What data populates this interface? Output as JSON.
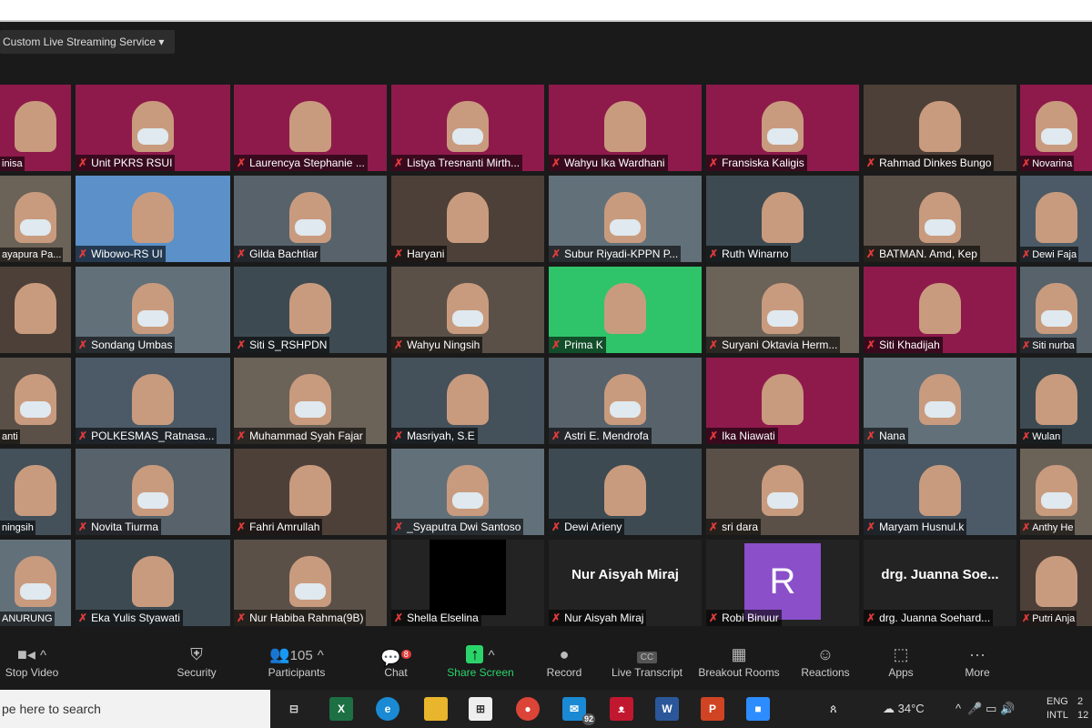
{
  "meeting": {
    "stream_label": "Custom Live Streaming Service",
    "active_speaker": "Unit PKRS RSUI"
  },
  "grid": [
    [
      "inisa",
      "Unit PKRS RSUI",
      "Laurencya Stephanie ...",
      "Listya Tresnanti Mirth...",
      "Wahyu Ika Wardhani",
      "Fransiska Kaligis",
      "Rahmad Dinkes Bungo",
      "Novarina"
    ],
    [
      "ayapura Pa...",
      "Wibowo-RS UI",
      "Gilda Bachtiar",
      "Haryani",
      "Subur Riyadi-KPPN P...",
      "Ruth Winarno",
      "BATMAN. Amd, Kep",
      "Dewi Faja"
    ],
    [
      "",
      "Sondang Umbas",
      "Siti S_RSHPDN",
      "Wahyu Ningsih",
      "Prima K",
      "Suryani Oktavia Herm...",
      "Siti Khadijah",
      "Siti nurba"
    ],
    [
      "anti",
      "POLKESMAS_Ratnasa...",
      "Muhammad Syah Fajar",
      "Masriyah, S.E",
      "Astri E. Mendrofa",
      "Ika Niawati",
      "Nana",
      "Wulan"
    ],
    [
      "ningsih",
      "Novita Tiurma",
      "Fahri Amrullah",
      "_Syaputra Dwi Santoso",
      "Dewi Arieny",
      "sri dara",
      "Maryam Husnul.k",
      "Anthy He"
    ],
    [
      "ANURUNG",
      "Eka Yulis Styawati",
      "Nur Habiba Rahma(9B)",
      "Shella Elselina",
      "Nur Aisyah Miraj",
      "Robi Binuur",
      "drg. Juanna Soehard...",
      "Putri Anja"
    ]
  ],
  "no_video_tiles": {
    "Nur Aisyah Miraj": {
      "center_text": "Nur Aisyah Miraj"
    },
    "Robi Binuur": {
      "avatar_letter": "R",
      "avatar_color": "#8a4fc9"
    },
    "drg. Juanna Soehard...": {
      "center_text": "drg. Juanna Soe..."
    },
    "Shella Elselina": {
      "black": true
    }
  },
  "toolbar": {
    "stop_video": "Stop Video",
    "security": "Security",
    "participants": "Participants",
    "participant_count": "105",
    "chat": "Chat",
    "chat_badge": "8",
    "share_screen": "Share Screen",
    "record": "Record",
    "live_transcript": "Live Transcript",
    "breakout_rooms": "Breakout Rooms",
    "reactions": "Reactions",
    "apps": "Apps",
    "more": "More",
    "cc": "CC"
  },
  "taskbar": {
    "search_placeholder": "pe here to search",
    "mail_badge": "92",
    "weather": "34°C",
    "lang1": "ENG",
    "lang2": "INTL",
    "clock_partial": "2",
    "date_partial": "12"
  },
  "colors": {
    "banner": "#8e1a4c",
    "share_green": "#2bd46a",
    "muted_mic": "#e23b3b"
  }
}
